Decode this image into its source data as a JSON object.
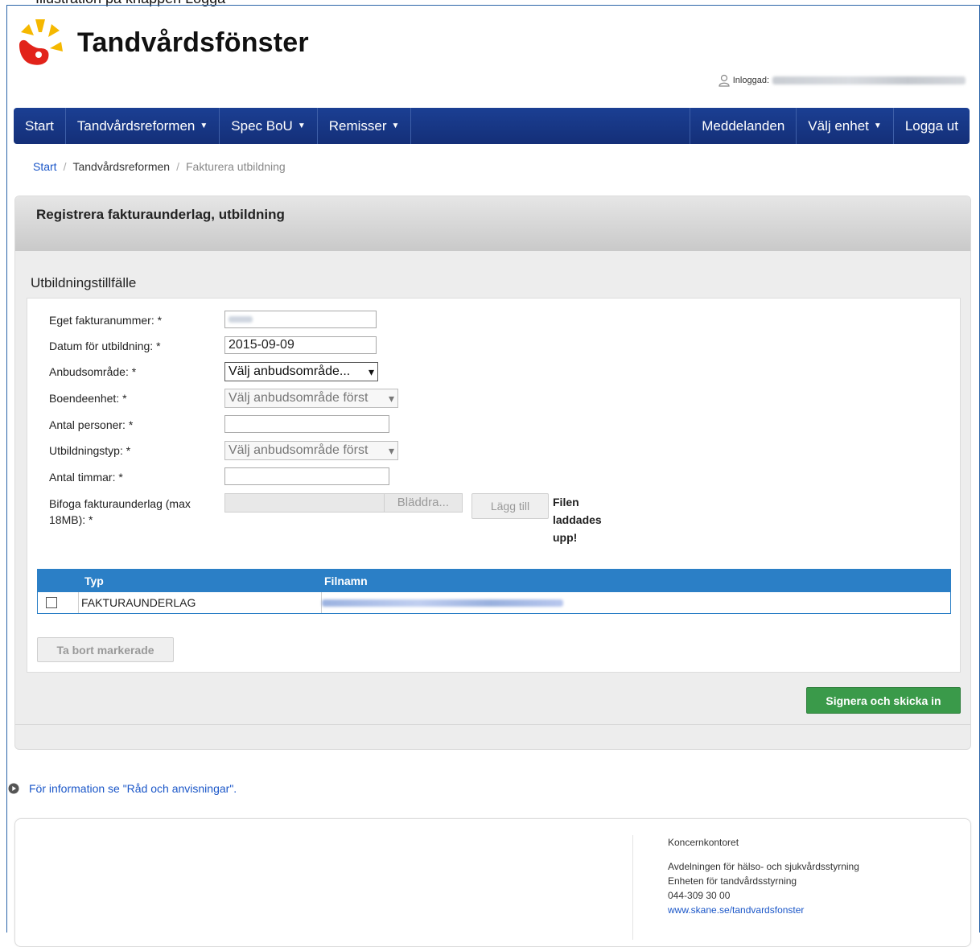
{
  "page_caption": "Illustration på knappen Logga",
  "header": {
    "brand": "Tandvårdsfönster",
    "logged_in_label": "Inloggad:"
  },
  "nav": {
    "left": [
      {
        "label": "Start",
        "caret": false
      },
      {
        "label": "Tandvårdsreformen",
        "caret": true
      },
      {
        "label": "Spec BoU",
        "caret": true
      },
      {
        "label": "Remisser",
        "caret": true
      }
    ],
    "right": [
      {
        "label": "Meddelanden",
        "caret": false
      },
      {
        "label": "Välj enhet",
        "caret": true
      },
      {
        "label": "Logga ut",
        "caret": false
      }
    ]
  },
  "breadcrumb": {
    "start": "Start",
    "section": "Tandvårdsreformen",
    "current": "Fakturera utbildning",
    "separator": "/"
  },
  "panel": {
    "title": "Registrera fakturaunderlag, utbildning",
    "section_title": "Utbildningstillfälle"
  },
  "form": {
    "invoice_number_label": "Eget fakturanummer: *",
    "date_label": "Datum för utbildning: *",
    "date_value": "2015-09-09",
    "area_label": "Anbudsområde: *",
    "area_value": "Välj anbudsområde...",
    "housing_label": "Boendeenhet: *",
    "housing_value": "Välj anbudsområde först",
    "persons_label": "Antal personer: *",
    "type_label": "Utbildningstyp: *",
    "type_value": "Välj anbudsområde först",
    "hours_label": "Antal timmar: *",
    "attach_label": "Bifoga fakturaunderlag (max 18MB): *",
    "browse_label": "Bläddra...",
    "add_label": "Lägg till",
    "upload_message": "Filen laddades upp!"
  },
  "file_table": {
    "col_type": "Typ",
    "col_filename": "Filnamn",
    "rows": [
      {
        "type": "FAKTURAUNDERLAG"
      }
    ]
  },
  "buttons": {
    "remove_marked": "Ta bort markerade",
    "sign_submit": "Signera och skicka in"
  },
  "info_link": "För information se \"Råd och anvisningar\".",
  "footer": {
    "title": "Koncernkontoret",
    "line1": "Avdelningen för hälso- och sjukvårdsstyrning",
    "line2": "Enheten för tandvårdsstyrning",
    "phone": "044-309 30 00",
    "link": "www.skane.se/tandvardsfonster"
  },
  "colors": {
    "nav_bg": "#1b3f93",
    "table_header": "#2b7fc6",
    "sign_button": "#3a9a4a",
    "link": "#1a56c8",
    "logo_red": "#e2231a",
    "logo_yellow": "#f5b800"
  },
  "icons": {
    "logo": "tandvardsfonster-logo",
    "user": "user-icon",
    "info": "play-circle-icon",
    "select_arrow": "chevron-down-icon",
    "nav_caret": "caret-down-icon"
  }
}
